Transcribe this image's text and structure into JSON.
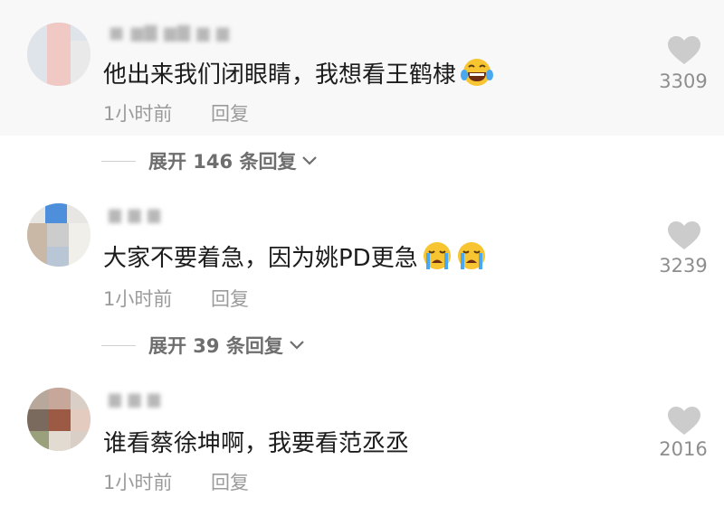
{
  "comments": [
    {
      "username": "■ ▆▇ ▆▇ ▆ ▆",
      "text": "他出来我们闭眼睛，我想看王鹤棣",
      "emoji": "laughing-tears",
      "time": "1小时前",
      "reply": "回复",
      "likes": "3309",
      "expand": "展开 146 条回复"
    },
    {
      "username": "▆ ▆ ▆",
      "text": "大家不要着急，因为姚PD更急",
      "emoji": "crying x2",
      "time": "1小时前",
      "reply": "回复",
      "likes": "3239",
      "expand": "展开 39 条回复"
    },
    {
      "username": "▆ ▆ ▆",
      "text": "谁看蔡徐坤啊，我要看范丞丞",
      "emoji": "",
      "time": "1小时前",
      "reply": "回复",
      "likes": "2016"
    }
  ],
  "icons": {
    "like": "heart-icon",
    "expand": "chevron-down-icon"
  },
  "colors": {
    "highlight_bg": "#f8f8f8",
    "secondary_text": "#9b9b9b",
    "heart": "#cccccc"
  }
}
